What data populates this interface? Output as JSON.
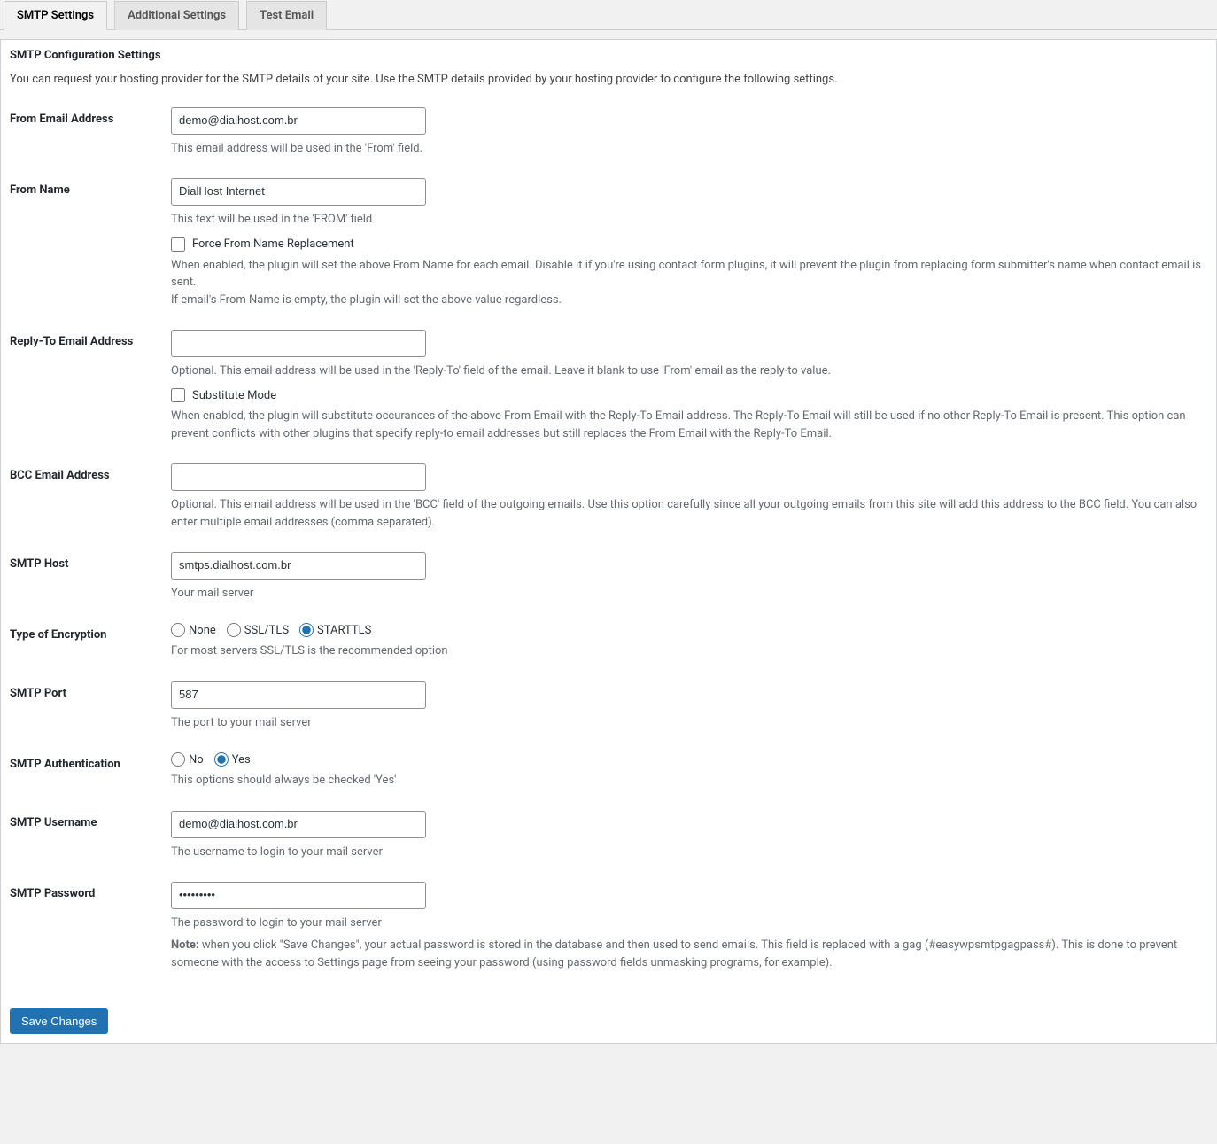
{
  "tabs": {
    "smtp": "SMTP Settings",
    "additional": "Additional Settings",
    "test": "Test Email"
  },
  "section": {
    "title": "SMTP Configuration Settings",
    "desc": "You can request your hosting provider for the SMTP details of your site. Use the SMTP details provided by your hosting provider to configure the following settings."
  },
  "fields": {
    "from_email": {
      "label": "From Email Address",
      "value": "demo@dialhost.com.br",
      "desc": "This email address will be used in the 'From' field."
    },
    "from_name": {
      "label": "From Name",
      "value": "DialHost Internet",
      "desc": "This text will be used in the 'FROM' field",
      "force_label": "Force From Name Replacement",
      "force_desc1": "When enabled, the plugin will set the above From Name for each email. Disable it if you're using contact form plugins, it will prevent the plugin from replacing form submitter's name when contact email is sent.",
      "force_desc2": "If email's From Name is empty, the plugin will set the above value regardless."
    },
    "reply_to": {
      "label": "Reply-To Email Address",
      "value": "",
      "desc": "Optional. This email address will be used in the 'Reply-To' field of the email. Leave it blank to use 'From' email as the reply-to value.",
      "sub_label": "Substitute Mode",
      "sub_desc": "When enabled, the plugin will substitute occurances of the above From Email with the Reply-To Email address. The Reply-To Email will still be used if no other Reply-To Email is present. This option can prevent conflicts with other plugins that specify reply-to email addresses but still replaces the From Email with the Reply-To Email."
    },
    "bcc": {
      "label": "BCC Email Address",
      "value": "",
      "desc": "Optional. This email address will be used in the 'BCC' field of the outgoing emails. Use this option carefully since all your outgoing emails from this site will add this address to the BCC field. You can also enter multiple email addresses (comma separated)."
    },
    "host": {
      "label": "SMTP Host",
      "value": "smtps.dialhost.com.br",
      "desc": "Your mail server"
    },
    "encryption": {
      "label": "Type of Encryption",
      "none": "None",
      "ssl": "SSL/TLS",
      "starttls": "STARTTLS",
      "desc": "For most servers SSL/TLS is the recommended option"
    },
    "port": {
      "label": "SMTP Port",
      "value": "587",
      "desc": "The port to your mail server"
    },
    "auth": {
      "label": "SMTP Authentication",
      "no": "No",
      "yes": "Yes",
      "desc": "This options should always be checked 'Yes'"
    },
    "username": {
      "label": "SMTP Username",
      "value": "demo@dialhost.com.br",
      "desc": "The username to login to your mail server"
    },
    "password": {
      "label": "SMTP Password",
      "value": "•••••••••",
      "desc": "The password to login to your mail server",
      "note_prefix": "Note:",
      "note": " when you click \"Save Changes\", your actual password is stored in the database and then used to send emails. This field is replaced with a gag (#easywpsmtpgagpass#). This is done to prevent someone with the access to Settings page from seeing your password (using password fields unmasking programs, for example)."
    }
  },
  "submit": {
    "label": "Save Changes"
  }
}
